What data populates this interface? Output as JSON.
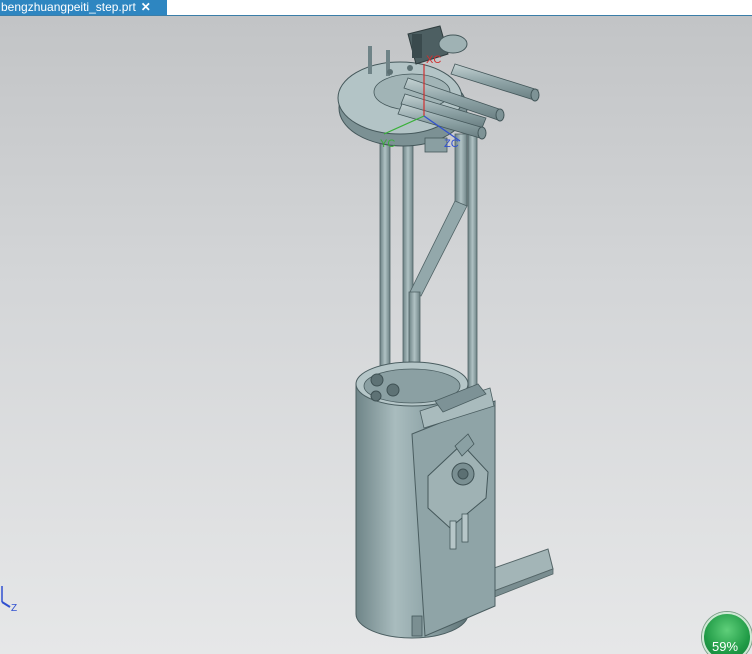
{
  "tab": {
    "title": "bengzhuangpeiti_step.prt",
    "close_icon": "close-icon"
  },
  "wcs": {
    "xc_label": "XC",
    "yc_label": "YC",
    "zc_label": "ZC"
  },
  "triad": {
    "z_label": "Z"
  },
  "zoom": {
    "value_label": "59%"
  },
  "colors": {
    "tab_blue": "#2e86c1",
    "model_fill": "#8fa5a8",
    "xc_color": "#d03030",
    "yc_color": "#38b038",
    "zc_color": "#3050d0",
    "zoom_green": "#1f9a45"
  }
}
